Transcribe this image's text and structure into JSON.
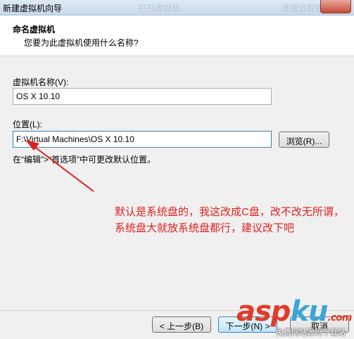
{
  "window": {
    "title": "新建虚拟机向导",
    "ghost_tabs": [
      "打开虚拟机",
      "连接远程服务器"
    ]
  },
  "header": {
    "title": "命名虚拟机",
    "subtitle": "您要为此虚拟机使用什么名称?"
  },
  "vm_name": {
    "label": "虚拟机名称(V):",
    "value": "OS X 10.10"
  },
  "location": {
    "label": "位置(L):",
    "value": "F:\\Virtual Machines\\OS X 10.10",
    "browse_label": "浏览(R)...",
    "hint": "在“编辑”>“首选项”中可更改默认位置。"
  },
  "annotation": {
    "text": "默认是系统盘的，我这改成C盘，改不改无所谓，系统盘大就放系统盘都行，建议改下吧",
    "color": "#e02020"
  },
  "footer": {
    "back_label": "< 上一步(B)",
    "next_label": "下一步(N) >",
    "cancel_label": "取消"
  },
  "watermark": {
    "brand_part1": "asp",
    "brand_part2": "ku",
    "brand_tld": ".com",
    "tagline": "免费网站源码下载站"
  }
}
